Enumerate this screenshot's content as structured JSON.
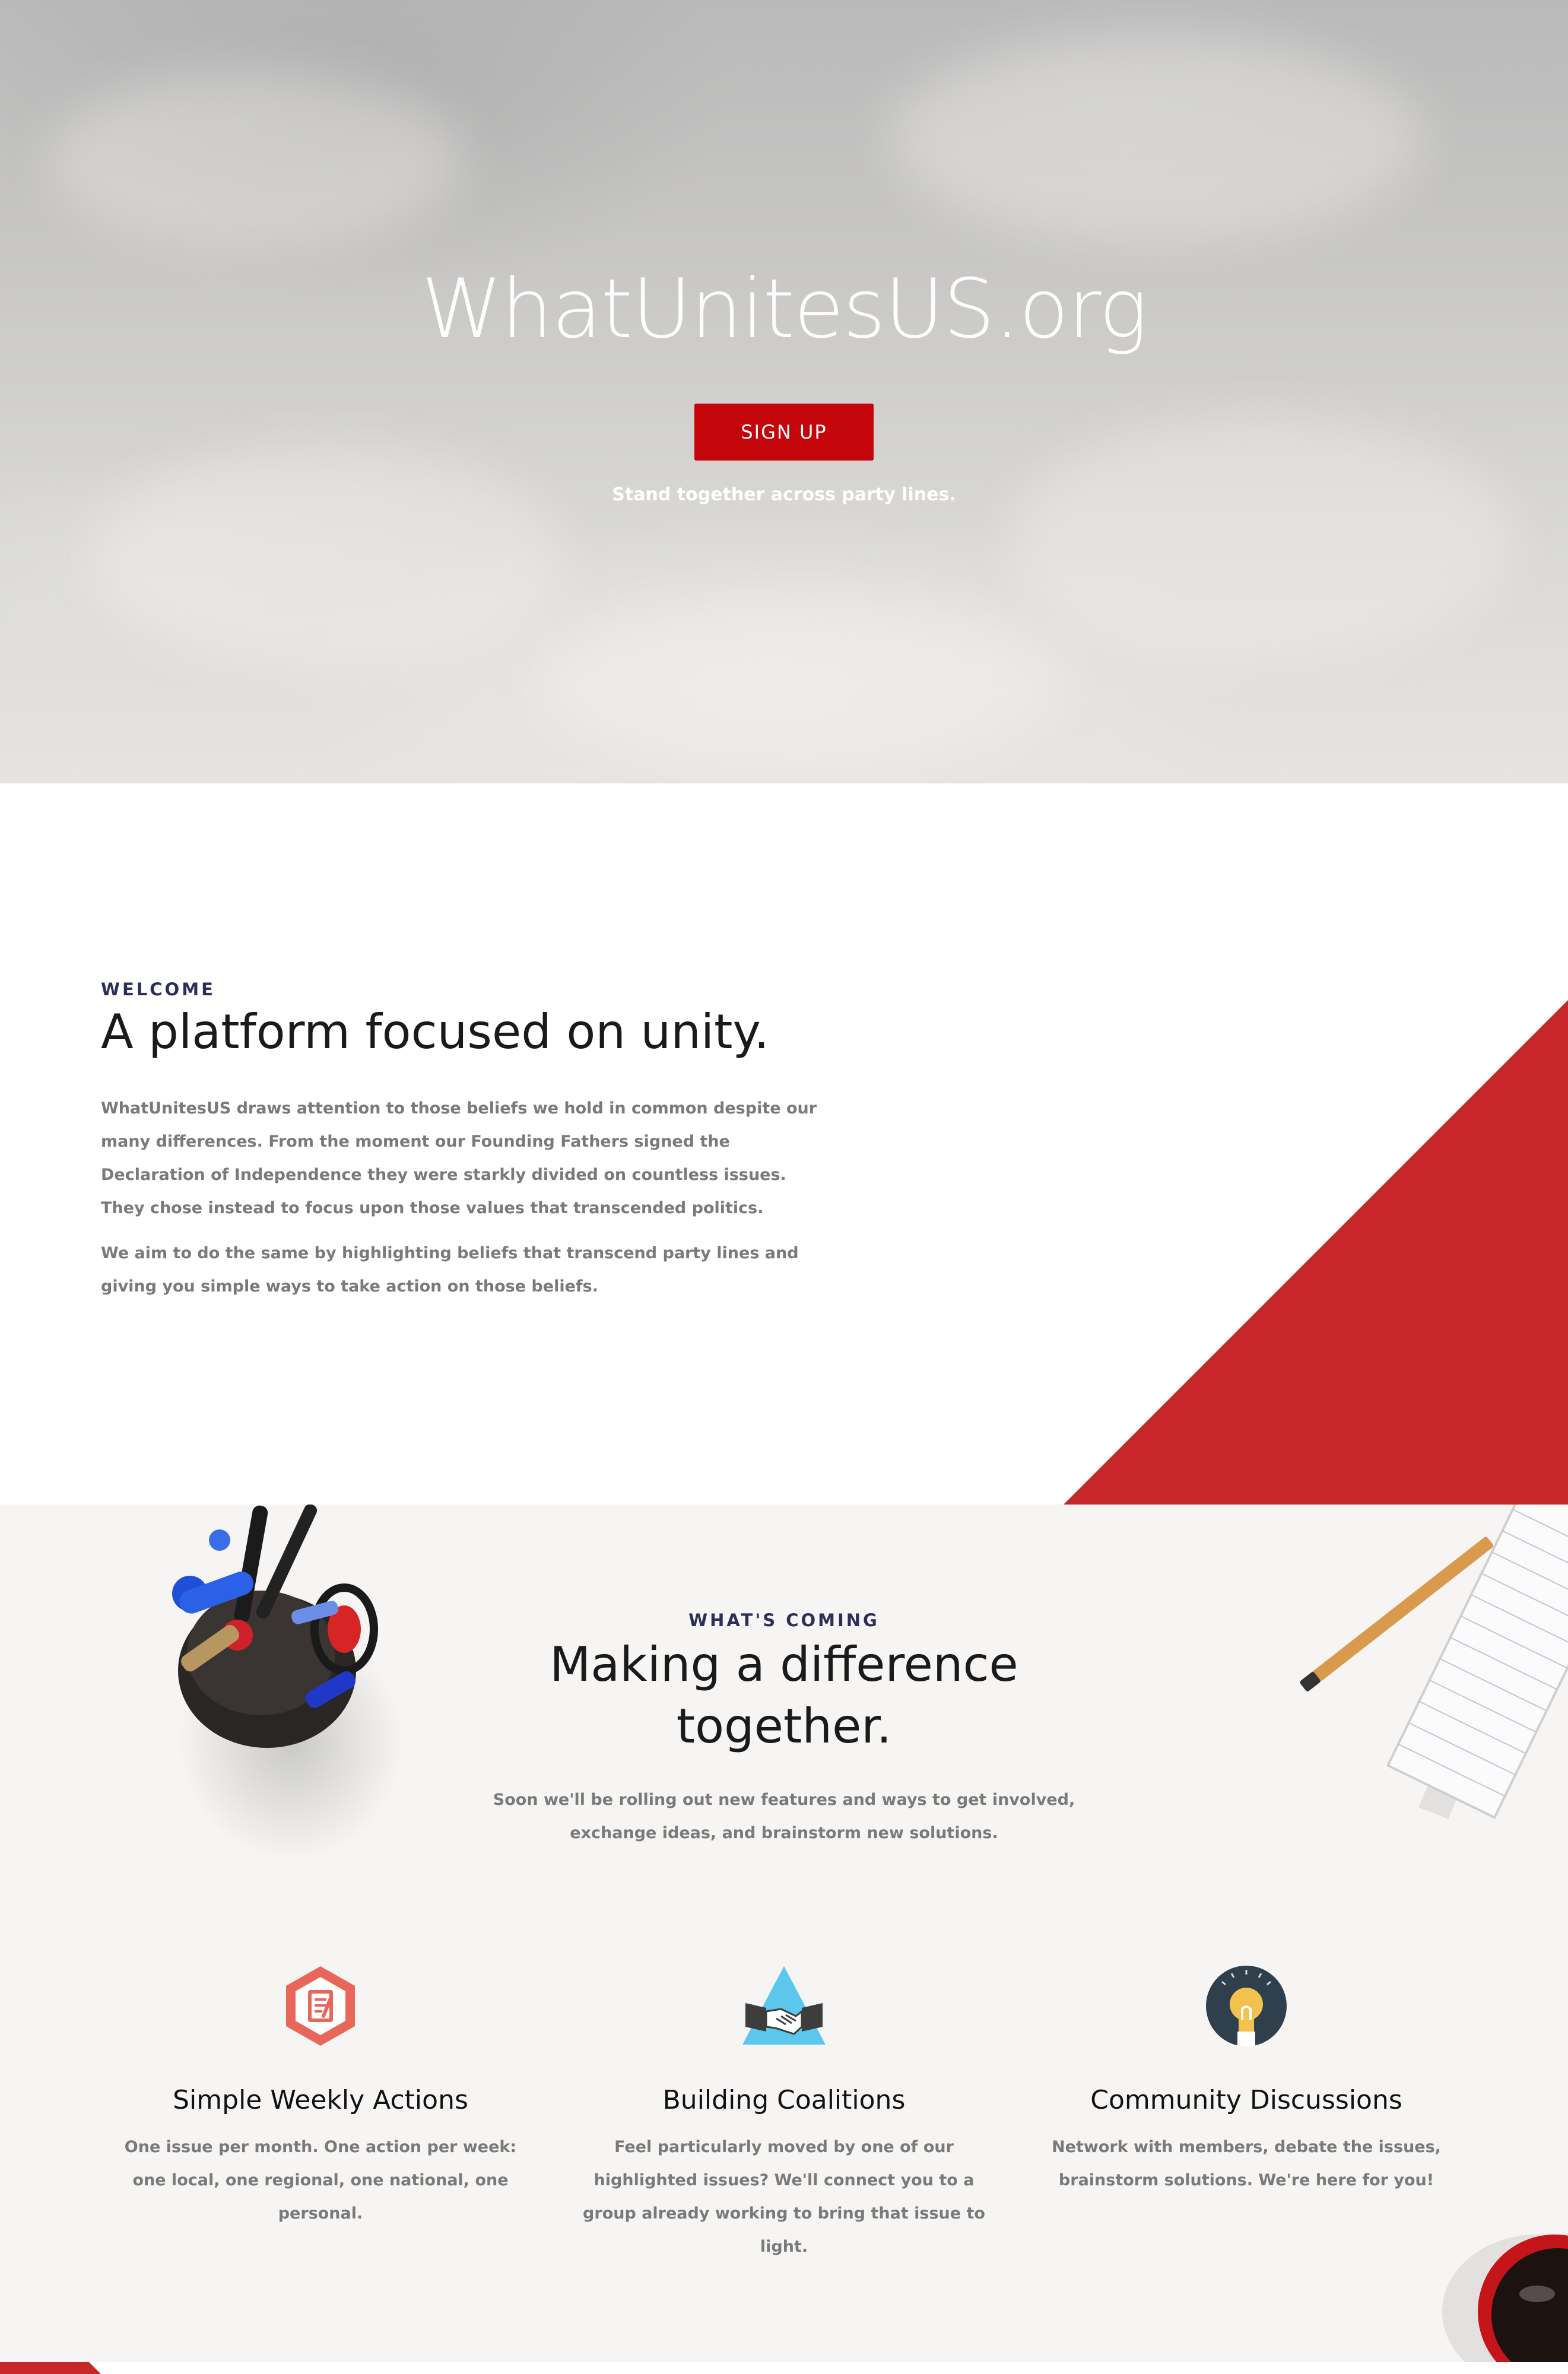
{
  "hero": {
    "title": "WhatUnitesUS.org",
    "signup_label": "SIGN UP",
    "tagline": "Stand together across party lines."
  },
  "welcome": {
    "eyebrow": "WELCOME",
    "heading": "A platform focused on unity.",
    "paragraphs": [
      "WhatUnitesUS draws attention to those beliefs we hold in common despite our many differences. From the moment our Founding Fathers signed the Declaration of Independence they were starkly divided on countless issues. They chose instead to focus upon those values that transcended politics.",
      "We aim to do the same by highlighting beliefs that transcend party lines and giving you simple ways to take action on those beliefs."
    ]
  },
  "coming": {
    "eyebrow": "WHAT'S COMING",
    "heading_line1": "Making a difference",
    "heading_line2": "together.",
    "body": "Soon we'll be rolling out new features and ways to get involved, exchange ideas, and brainstorm new solutions.",
    "features": [
      {
        "icon": "notepad-hexagon-icon",
        "title": "Simple Weekly Actions",
        "text": "One issue per month. One action per week: one local, one regional, one national, one personal."
      },
      {
        "icon": "handshake-triangle-icon",
        "title": "Building Coalitions",
        "text": "Feel particularly moved by one of our highlighted issues? We'll connect you to a group already working to bring that issue to light."
      },
      {
        "icon": "lightbulb-circle-icon",
        "title": "Community Discussions",
        "text": "Network with members, debate the issues, brainstorm solutions. We're here for you!"
      }
    ]
  },
  "colors": {
    "accent_red": "#c4060b",
    "triangle_red": "#c8272a",
    "eyebrow_navy": "#2c2f5a",
    "body_gray": "#7a7a7a",
    "section_bg": "#f6f5f4"
  }
}
